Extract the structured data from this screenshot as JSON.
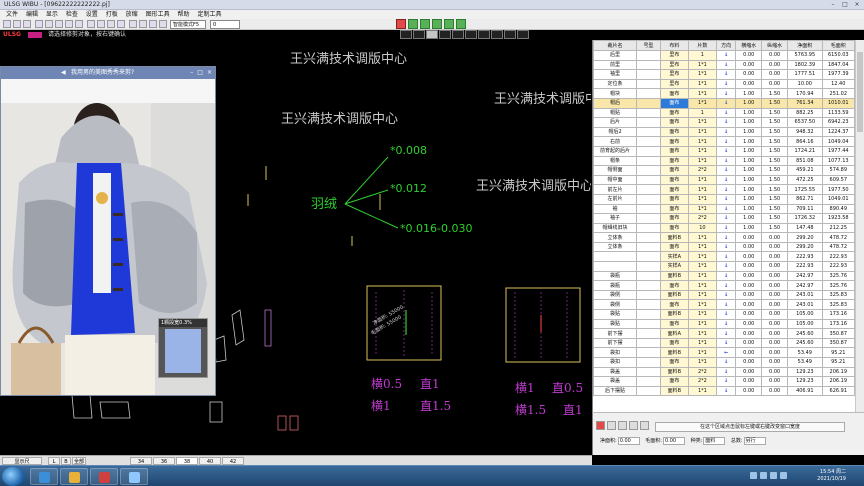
{
  "window": {
    "title": "ULSG WIBU - [09622222222222.pj]"
  },
  "menu": [
    "文件",
    "编辑",
    "显示",
    "检查",
    "设置",
    "打板",
    "放缩",
    "图形工具",
    "帮助",
    "定制工具"
  ],
  "toolbar": {
    "mode_select": "智能模式F5",
    "value_input": "0"
  },
  "status": {
    "logo": "ULSG",
    "message": "请选择修剪对象，按右键确认"
  },
  "canvas": {
    "watermarks": [
      "王兴满技术调版中心",
      "王兴满技术调版中心",
      "王兴满技术调版中心",
      "王兴满技术调版中心"
    ],
    "grain_label": "羽绒",
    "grain_values": [
      "*0.008",
      "*0.012",
      "*0.016-0.030"
    ],
    "piece_texts": [
      "净面积: 55000",
      "毛面积: 55000"
    ],
    "scale_left": [
      "横0.5",
      "直1",
      "横1",
      "直1.5"
    ],
    "scale_right": [
      "横1",
      "直0.5",
      "横1.5",
      "直1"
    ]
  },
  "popup": {
    "title": "我用男的美图秀秀来剪?",
    "mini_caption": "1颗段宽0.3%"
  },
  "table": {
    "headers": [
      "裁片名",
      "号型",
      "布料",
      "片数",
      "方向",
      "横缩水",
      "纵缩水",
      "净面积",
      "毛面积"
    ],
    "rows": [
      [
        "后里",
        "",
        "里布",
        "1",
        "↓",
        "0.00",
        "0.00",
        "5763.95",
        "6150.03"
      ],
      [
        "前里",
        "",
        "里布",
        "1*1",
        "↓",
        "0.00",
        "0.00",
        "1802.39",
        "1847.04"
      ],
      [
        "袖里",
        "",
        "里布",
        "1*1",
        "↓",
        "0.00",
        "0.00",
        "1777.51",
        "1977.39"
      ],
      [
        "定位条",
        "",
        "里布",
        "1*1",
        "↓",
        "0.00",
        "0.00",
        "10.00",
        "12.40"
      ],
      [
        "帽块",
        "",
        "面布",
        "1*1",
        "↓",
        "1.00",
        "1.50",
        "170.94",
        "251.02"
      ],
      [
        "帽后",
        "",
        "面布",
        "1*1",
        "↓",
        "1.00",
        "1.50",
        "761.34",
        "1010.01"
      ],
      [
        "帽贴",
        "",
        "面布",
        "1",
        "↓",
        "1.00",
        "1.50",
        "882.25",
        "1133.59"
      ],
      [
        "后片",
        "",
        "面布",
        "1*1",
        "↓",
        "1.00",
        "1.50",
        "6537.50",
        "6942.23"
      ],
      [
        "帽后2",
        "",
        "面布",
        "1*1",
        "↓",
        "1.00",
        "1.50",
        "948.32",
        "1224.37"
      ],
      [
        "右前",
        "",
        "面布",
        "1*1",
        "↓",
        "1.00",
        "1.50",
        "864.16",
        "1049.04"
      ],
      [
        "前育起的后片",
        "",
        "面布",
        "1*1",
        "↓",
        "1.00",
        "1.50",
        "1724.21",
        "1977.44"
      ],
      [
        "帽条",
        "",
        "面布",
        "1*1",
        "↓",
        "1.00",
        "1.50",
        "851.08",
        "1077.13"
      ],
      [
        "帽侧面",
        "",
        "面布",
        "2*2",
        "↓",
        "1.00",
        "1.50",
        "459.21",
        "574.89"
      ],
      [
        "帽中面",
        "",
        "面布",
        "1*1",
        "↓",
        "1.00",
        "1.50",
        "472.25",
        "609.57"
      ],
      [
        "前左片",
        "",
        "面布",
        "1*1",
        "↓",
        "1.00",
        "1.50",
        "1725.55",
        "1977.50"
      ],
      [
        "左前片",
        "",
        "面布",
        "1*1",
        "↓",
        "1.00",
        "1.50",
        "862.71",
        "1049.01"
      ],
      [
        "袖",
        "",
        "面布",
        "1*1",
        "↓",
        "1.00",
        "1.50",
        "709.11",
        "890.49"
      ],
      [
        "袖子",
        "",
        "面布",
        "2*2",
        "↓",
        "1.00",
        "1.50",
        "1726.32",
        "1923.58"
      ],
      [
        "帽缉线旧块",
        "",
        "面布",
        "10",
        "↓",
        "1.00",
        "1.50",
        "147.48",
        "212.25"
      ],
      [
        "立体条",
        "",
        "面料B",
        "1*1",
        "↓",
        "0.00",
        "0.00",
        "299.20",
        "478.72"
      ],
      [
        "立体条",
        "",
        "面布",
        "1*1",
        "↓",
        "0.00",
        "0.00",
        "299.20",
        "478.72"
      ],
      [
        "",
        "",
        "实样A",
        "1*1",
        "↓",
        "0.00",
        "0.00",
        "222.93",
        "222.93"
      ],
      [
        "",
        "",
        "实样A",
        "1*1",
        "↓",
        "0.00",
        "0.00",
        "222.93",
        "222.93"
      ],
      [
        "袋瓶",
        "",
        "面料B",
        "1*1",
        "↓",
        "0.00",
        "0.00",
        "242.97",
        "325.76"
      ],
      [
        "袋瓶",
        "",
        "面布",
        "1*1",
        "↓",
        "0.00",
        "0.00",
        "242.97",
        "325.76"
      ],
      [
        "袋侧",
        "",
        "面料B",
        "1*1",
        "↓",
        "0.00",
        "0.00",
        "243.01",
        "325.83"
      ],
      [
        "袋侧",
        "",
        "面布",
        "1*1",
        "↓",
        "0.00",
        "0.00",
        "243.01",
        "325.83"
      ],
      [
        "袋贴",
        "",
        "面料B",
        "1*1",
        "↓",
        "0.00",
        "0.00",
        "105.00",
        "173.16"
      ],
      [
        "袋贴",
        "",
        "面布",
        "1*1",
        "↓",
        "0.00",
        "0.00",
        "105.00",
        "173.16"
      ],
      [
        "前下摆",
        "",
        "面料A",
        "1*1",
        "↓",
        "0.00",
        "0.00",
        "245.60",
        "350.87"
      ],
      [
        "前下摆",
        "",
        "面布",
        "1*1",
        "↓",
        "0.00",
        "0.00",
        "245.60",
        "350.87"
      ],
      [
        "袋扣",
        "",
        "面料B",
        "1*1",
        "←",
        "0.00",
        "0.00",
        "53.49",
        "95.21"
      ],
      [
        "袋扣",
        "",
        "面布",
        "1*1",
        "↓",
        "0.00",
        "0.00",
        "53.49",
        "95.21"
      ],
      [
        "袋盖",
        "",
        "面料B",
        "2*2",
        "↓",
        "0.00",
        "0.00",
        "129.23",
        "206.19"
      ],
      [
        "袋盖",
        "",
        "面布",
        "2*2",
        "↓",
        "0.00",
        "0.00",
        "129.23",
        "206.19"
      ],
      [
        "后下摆贴",
        "",
        "面料B",
        "1*1",
        "↓",
        "0.00",
        "0.00",
        "406.91",
        "626.91"
      ]
    ],
    "selected_row": 5
  },
  "info": {
    "hint": "在这个区域点击鼠标左键或右键改变窗口宽度",
    "net_area_label": "净面积:",
    "net_area_value": "0.00",
    "gross_area_label": "毛面积:",
    "gross_area_value": "0.00",
    "type_label": "种类:",
    "type_value": "面料",
    "total_label": "总数:",
    "total_value": "另行"
  },
  "sizebar": {
    "label": "显示尺",
    "items": [
      "L",
      "B",
      "全部",
      "34",
      "36",
      "38",
      "40",
      "42"
    ],
    "selected": "38"
  },
  "taskbar": {
    "time": "15:54 周二",
    "date": "2021/10/19"
  }
}
